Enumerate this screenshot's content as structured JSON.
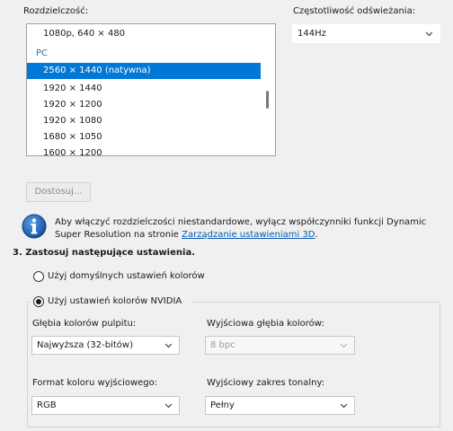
{
  "resolution": {
    "label": "Rozdzielczość:",
    "items": [
      {
        "text": "1080p, 640 × 480"
      },
      {
        "text": "PC"
      },
      {
        "text": "2560 × 1440 (natywna)"
      },
      {
        "text": "1920 × 1440"
      },
      {
        "text": "1920 × 1200"
      },
      {
        "text": "1920 × 1080"
      },
      {
        "text": "1680 × 1050"
      },
      {
        "text": "1600 × 1200"
      }
    ]
  },
  "refresh": {
    "label": "Częstotliwość odświeżania:",
    "value": "144Hz"
  },
  "customize_button": "Dostosuj...",
  "info": {
    "text": "Aby włączyć rozdzielczości niestandardowe, wyłącz współczynniki funkcji Dynamic Super Resolution na stronie ",
    "link": "Zarządzanie ustawieniami 3D",
    "end": "."
  },
  "section3": {
    "heading": "3. Zastosuj następujące ustawienia.",
    "radio_default": "Użyj domyślnych ustawień kolorów",
    "radio_nvidia": "Użyj ustawień kolorów NVIDIA",
    "desktop_depth": {
      "label": "Głębia kolorów pulpitu:",
      "value": "Najwyższa (32-bitów)"
    },
    "output_depth": {
      "label": "Wyjściowa głębia kolorów:",
      "value": "8 bpc"
    },
    "output_format": {
      "label": "Format koloru wyjściowego:",
      "value": "RGB"
    },
    "output_range": {
      "label": "Wyjściowy zakres tonalny:",
      "value": "Pełny"
    }
  }
}
